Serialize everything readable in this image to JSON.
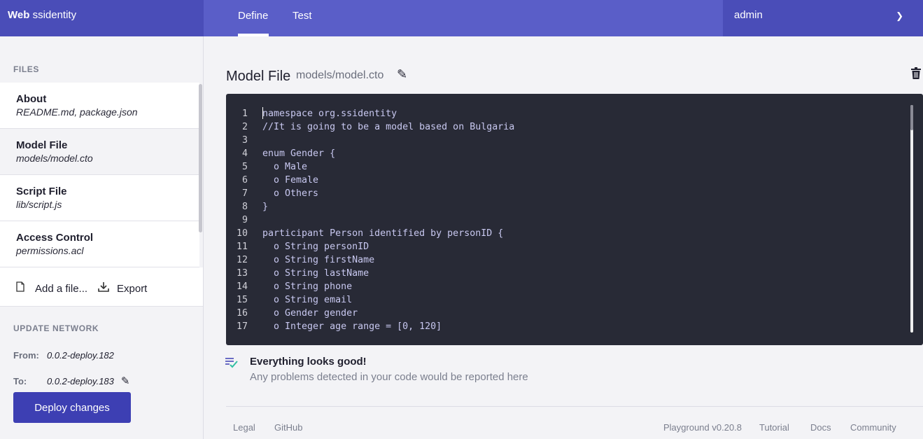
{
  "header": {
    "brand_bold": "Web",
    "brand_rest": " ssidentity",
    "tabs": [
      "Define",
      "Test"
    ],
    "user": "admin",
    "user_icon": "chevron-down-icon"
  },
  "sidebar": {
    "files_heading": "FILES",
    "files": [
      {
        "title": "About",
        "subtitle": "README.md, package.json"
      },
      {
        "title": "Model File",
        "subtitle": "models/model.cto"
      },
      {
        "title": "Script File",
        "subtitle": "lib/script.js"
      },
      {
        "title": "Access Control",
        "subtitle": "permissions.acl"
      }
    ],
    "add_file": "Add a file...",
    "export": "Export",
    "update_heading": "UPDATE NETWORK",
    "from_label": "From:",
    "from_value": "0.0.2-deploy.182",
    "to_label": "To:",
    "to_value": "0.0.2-deploy.183",
    "deploy_button": "Deploy changes"
  },
  "main": {
    "title": "Model File",
    "path": "models/model.cto",
    "editor": {
      "lines": [
        {
          "n": "1",
          "text": "namespace org.ssidentity"
        },
        {
          "n": "2",
          "text": "//It is going to be a model based on Bulgaria"
        },
        {
          "n": "3",
          "text": ""
        },
        {
          "n": "4",
          "text": "enum Gender {"
        },
        {
          "n": "5",
          "text": "  o Male"
        },
        {
          "n": "6",
          "text": "  o Female"
        },
        {
          "n": "7",
          "text": "  o Others"
        },
        {
          "n": "8",
          "text": "}"
        },
        {
          "n": "9",
          "text": ""
        },
        {
          "n": "10",
          "text": "participant Person identified by personID {"
        },
        {
          "n": "11",
          "text": "  o String personID"
        },
        {
          "n": "12",
          "text": "  o String firstName"
        },
        {
          "n": "13",
          "text": "  o String lastName"
        },
        {
          "n": "14",
          "text": "  o String phone"
        },
        {
          "n": "15",
          "text": "  o String email"
        },
        {
          "n": "16",
          "text": "  o Gender gender"
        },
        {
          "n": "17",
          "text": "  o Integer age range = [0, 120]"
        }
      ]
    },
    "status_title": "Everything looks good!",
    "status_text": "Any problems detected in your code would be reported here"
  },
  "footer": {
    "left": [
      "Legal",
      "GitHub"
    ],
    "right": [
      "Playground v0.20.8",
      "Tutorial",
      "Docs",
      "Community"
    ]
  },
  "colors": {
    "header": "#5a5ec8",
    "header_dark": "#4a4db8",
    "accent_button": "#3d3fb3",
    "editor_bg": "#282a36",
    "success": "#33bfa3"
  }
}
